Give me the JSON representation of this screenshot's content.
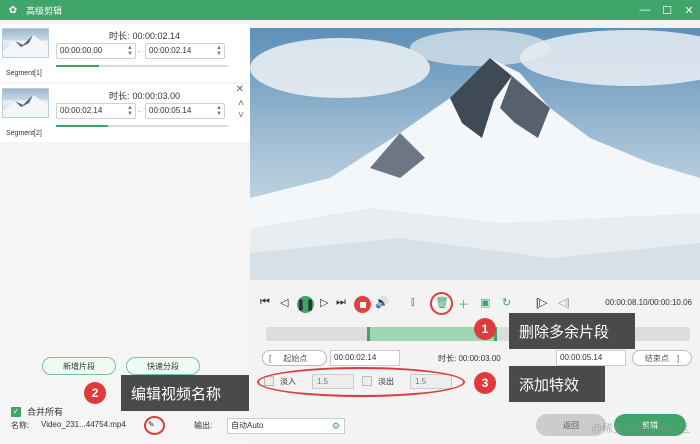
{
  "titlebar": {
    "title": "高级剪辑",
    "minimize": "—",
    "maximize": "☐",
    "close": "✕"
  },
  "segments": [
    {
      "label": "Segment[1]",
      "duration_label": "时长:",
      "duration": "00:00:02.14",
      "start": "00:00:00.00",
      "end": "00:00:02.14",
      "progress": 0.25
    },
    {
      "label": "Segment[2]",
      "duration_label": "时长:",
      "duration": "00:00:03.00",
      "start": "00:00:02.14",
      "end": "00:00:05.14",
      "progress": 0.3
    }
  ],
  "left": {
    "add_segment": "新增片段",
    "quick_split": "快速分段",
    "merge_all": "合并所有"
  },
  "player": {
    "time": "00:00:08.10/00:00:10.06"
  },
  "trim": {
    "start_label": "起始点",
    "start": "00:00:02.14",
    "duration_label": "时长:",
    "duration": "00:00:03.00",
    "end": "00:00:05.14",
    "end_label": "结束点"
  },
  "effects": {
    "fade_in": "淡入",
    "fade_in_value": "1.5",
    "fade_out": "淡出",
    "fade_out_value": "1.5"
  },
  "bottom": {
    "name_label": "名称:",
    "name": "Video_231...44754.mp4",
    "output_label": "输出:",
    "output": "自动Auto",
    "back": "返回",
    "cut": "剪辑"
  },
  "callouts": [
    {
      "num": "1",
      "text": "删除多余片段"
    },
    {
      "num": "2",
      "text": "编辑视频名称"
    },
    {
      "num": "3",
      "text": "添加特效"
    }
  ],
  "watermark": "@稀土掘金技术社区",
  "colors": {
    "accent": "#3fa56a",
    "highlight": "#e03b3b"
  }
}
